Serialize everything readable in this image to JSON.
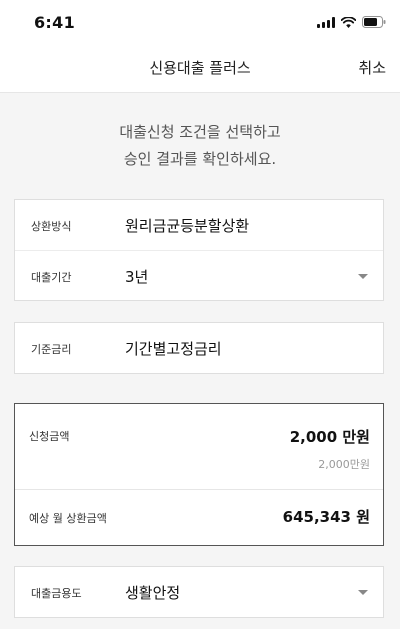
{
  "status_bar": {
    "time": "6:41"
  },
  "nav": {
    "title": "신용대출 플러스",
    "cancel": "취소"
  },
  "instruction": {
    "line1": "대출신청 조건을 선택하고",
    "line2": "승인 결과를 확인하세요."
  },
  "repayment": {
    "method_label": "상환방식",
    "method_value": "원리금균등분할상환",
    "period_label": "대출기간",
    "period_value": "3년"
  },
  "base_rate": {
    "label": "기준금리",
    "value": "기간별고정금리"
  },
  "amount": {
    "label": "신청금액",
    "value": "2,000 만원",
    "sub_value": "2,000만원",
    "estimate_label": "예상 월 상환금액",
    "estimate_value": "645,343 원"
  },
  "purpose": {
    "label": "대출금용도",
    "value": "생활안정"
  },
  "icons": [
    "signal-icon",
    "wifi-icon",
    "battery-icon",
    "chevron-down-icon"
  ]
}
